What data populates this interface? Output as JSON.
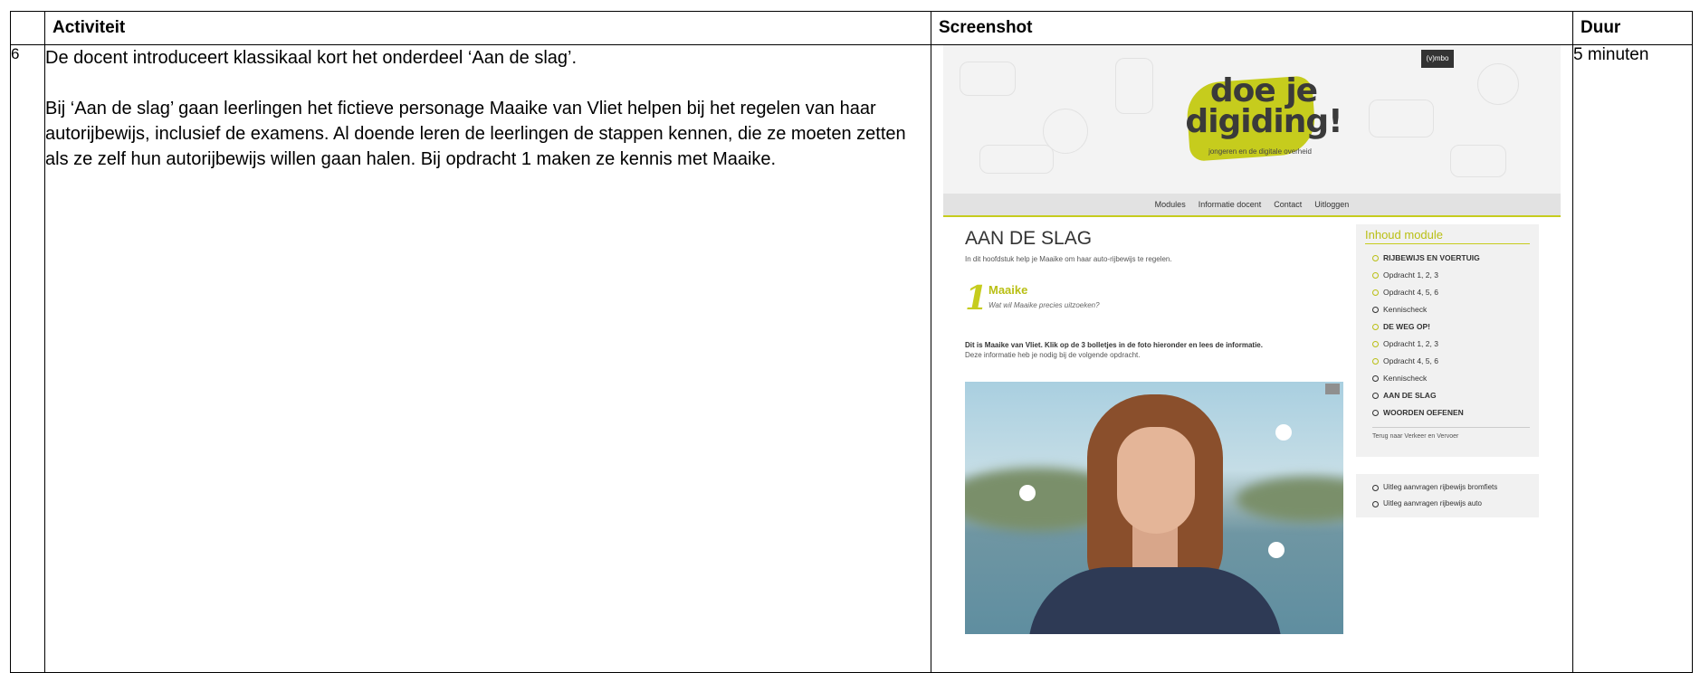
{
  "table": {
    "headers": {
      "num": "",
      "activity": "Activiteit",
      "screenshot": "Screenshot",
      "duration": "Duur"
    },
    "row": {
      "num": "6",
      "paragraphs": [
        "De docent introduceert klassikaal kort het onderdeel ‘Aan de slag’.",
        "Bij ‘Aan de slag’ gaan leerlingen het fictieve personage Maaike van Vliet helpen bij het regelen van haar autorijbewijs, inclusief de examens. Al doende leren de leerlingen de stappen kennen, die ze moeten zetten als ze zelf hun autorijbewijs willen gaan halen. Bij opdracht 1 maken ze kennis met Maaike."
      ],
      "duration": "5 minuten"
    }
  },
  "site": {
    "badge": "(v)mbo",
    "logo_line1": "doe je",
    "logo_line2": "digiding!",
    "logo_sub": "jongeren en de digitale overheid",
    "nav": [
      "Modules",
      "Informatie docent",
      "Contact",
      "Uitloggen"
    ],
    "page_title": "AAN DE SLAG",
    "intro": "In dit hoofdstuk help je Maaike om haar auto-rijbewijs te regelen.",
    "step_number": "1",
    "step_title": "Maaike",
    "step_subtitle": "Wat wil Maaike precies uitzoeken?",
    "instruction_bold": "Dit is Maaike van Vliet. Klik op de 3 bolletjes in de foto hieronder en lees de informatie.",
    "instruction_plain": "Deze informatie heb je nodig bij de volgende opdracht.",
    "sidebar_title": "Inhoud module",
    "sidebar_items": [
      "RIJBEWIJS EN VOERTUIG",
      "Opdracht 1, 2, 3",
      "Opdracht 4, 5, 6",
      "Kennischeck",
      "DE WEG OP!",
      "Opdracht 1, 2, 3",
      "Opdracht 4, 5, 6",
      "Kennischeck",
      "AAN DE SLAG",
      "WOORDEN OEFENEN"
    ],
    "sidebar_back": "Terug naar Verkeer en Vervoer",
    "sidebar2_items": [
      "Uitleg aanvragen rijbewijs bromfiets",
      "Uitleg aanvragen rijbewijs auto"
    ],
    "accent_color": "#c6cc1d"
  }
}
